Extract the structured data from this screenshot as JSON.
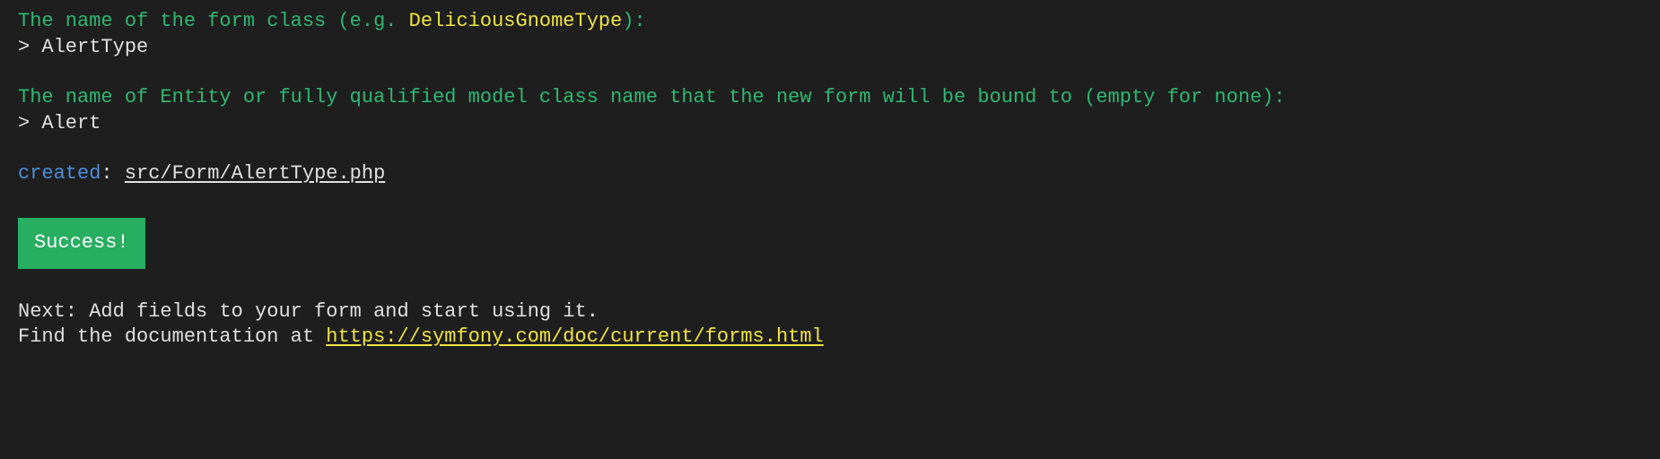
{
  "prompt1": {
    "text_before": "The name of the form class (e.g. ",
    "example": "DeliciousGnomeType",
    "text_after": "):"
  },
  "input1": {
    "prefix": "> ",
    "value": "AlertType"
  },
  "prompt2": "The name of Entity or fully qualified model class name that the new form will be bound to (empty for none):",
  "input2": {
    "prefix": "> ",
    "value": "Alert"
  },
  "created": {
    "label": "created",
    "separator": ": ",
    "path": "src/Form/AlertType.php"
  },
  "success_badge": " Success! ",
  "next": {
    "prefix": "Next: ",
    "text": "Add fields to your form and start using it."
  },
  "docs": {
    "prefix": "Find the documentation at ",
    "url": "https://symfony.com/doc/current/forms.html"
  }
}
